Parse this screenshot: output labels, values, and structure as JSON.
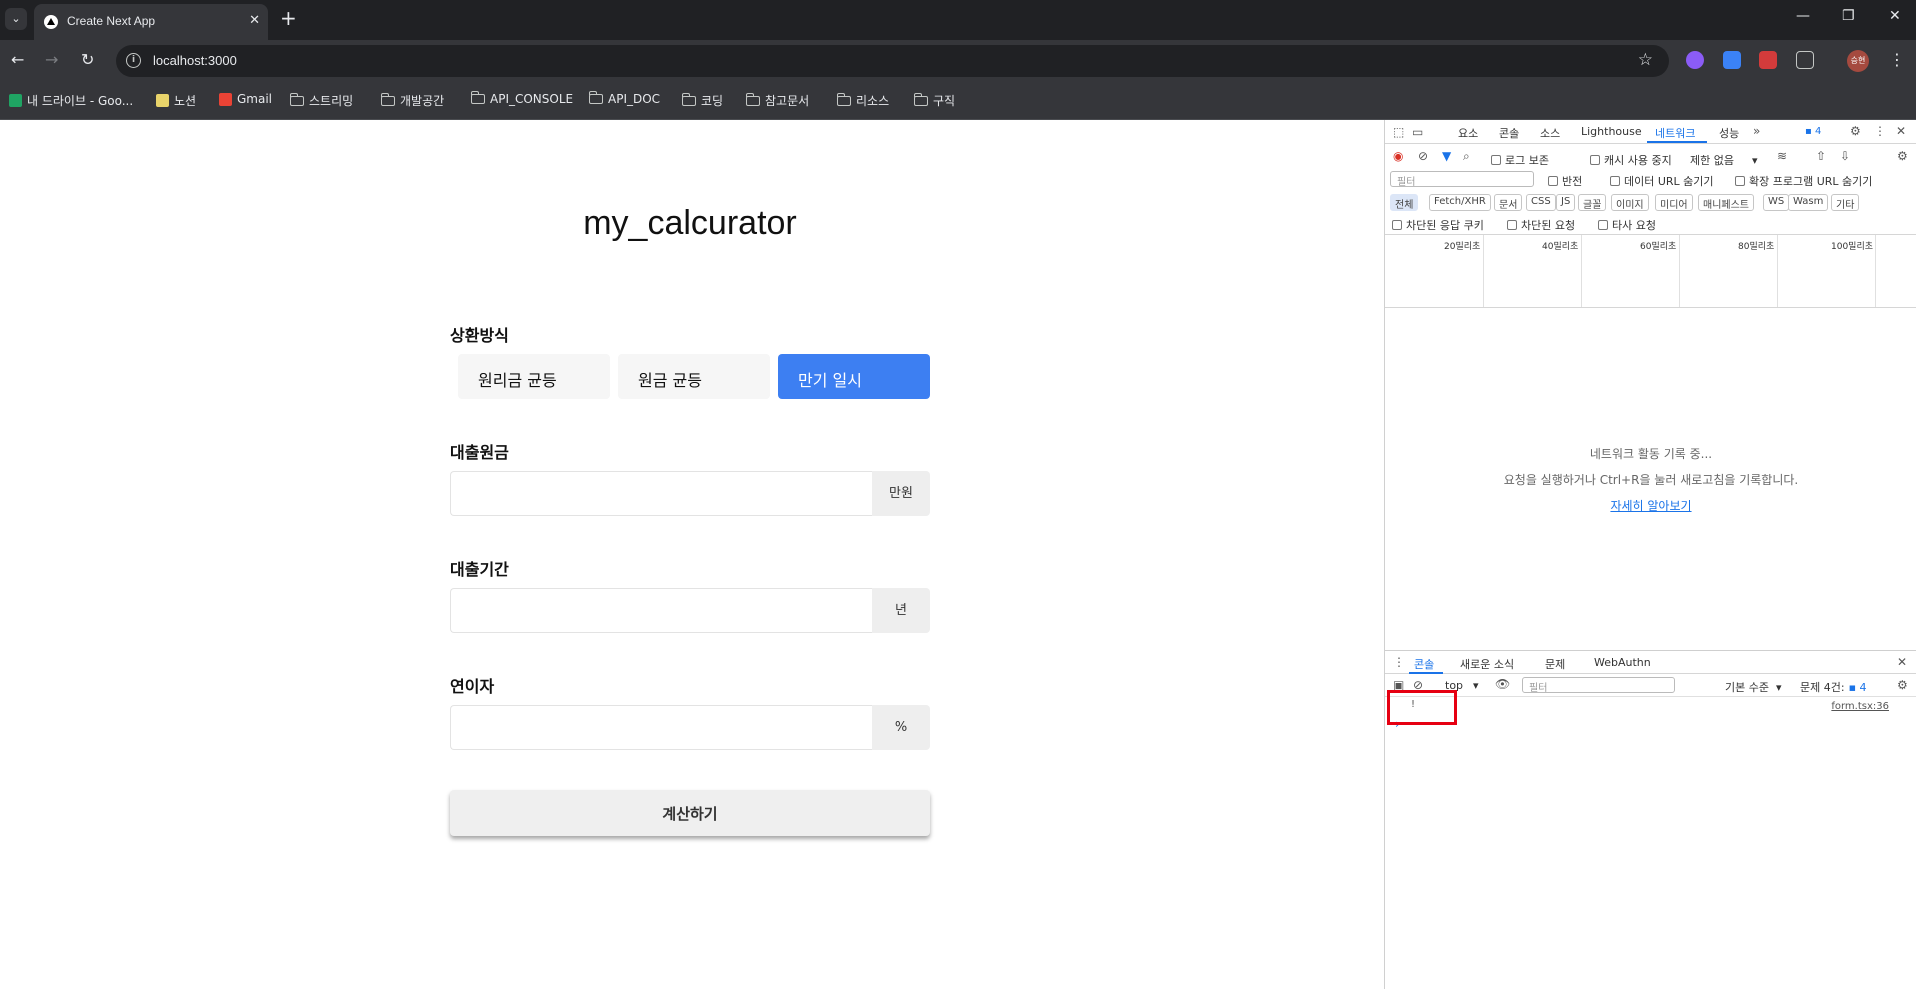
{
  "browser": {
    "tab_title": "Create Next App",
    "url": "localhost:3000",
    "profile_initials": "승현",
    "bookmarks": [
      "내 드라이브 - Goo...",
      "노션",
      "Gmail",
      "스트리밍",
      "개발공간",
      "API_CONSOLE",
      "API_DOC",
      "코딩",
      "참고문서",
      "리소스",
      "구직"
    ]
  },
  "page": {
    "title": "my_calcurator",
    "repayment_label": "상환방식",
    "repayment_options": [
      "원리금 균등",
      "원금 균등",
      "만기 일시"
    ],
    "selected_option": "만기 일시",
    "principal_label": "대출원금",
    "principal_value": "",
    "principal_unit": "만원",
    "period_label": "대출기간",
    "period_value": "",
    "period_unit": "년",
    "rate_label": "연이자",
    "rate_value": "",
    "rate_unit": "%",
    "submit_label": "계산하기",
    "accent_color": "#3d7ff2"
  },
  "devtools": {
    "main_tabs": [
      "요소",
      "콘솔",
      "소스",
      "Lighthouse",
      "네트워크",
      "성능"
    ],
    "active_tab": "네트워크",
    "issue_badge": "4",
    "network": {
      "preserve_log": "로그 보존",
      "disable_cache": "캐시 사용 중지",
      "throttling": "제한 없음",
      "filter_placeholder": "필터",
      "invert": "반전",
      "hide_data_urls": "데이터 URL 숨기기",
      "hide_ext_urls": "확장 프로그램 URL 숨기기",
      "type_filters": [
        "전체",
        "Fetch/XHR",
        "문서",
        "CSS",
        "JS",
        "글꼴",
        "이미지",
        "미디어",
        "매니페스트",
        "WS",
        "Wasm",
        "기타"
      ],
      "blocked_cookies": "차단된 응답 쿠키",
      "blocked_requests": "차단된 요청",
      "third_party": "타사 요청",
      "timeline_labels": [
        "20밀리초",
        "40밀리초",
        "60밀리초",
        "80밀리초",
        "100밀리초"
      ],
      "recording_msg": "네트워크 활동 기록 중...",
      "instruction_msg": "요청을 실행하거나 Ctrl+R을 눌러 새로고침을 기록합니다.",
      "learn_more": "자세히 알아보기"
    },
    "drawer": {
      "tabs": [
        "콘솔",
        "새로운 소식",
        "문제",
        "WebAuthn"
      ],
      "context": "top",
      "filter_placeholder": "필터",
      "levels": "기본 수준",
      "issues_label": "문제 4건:",
      "issues_count": "4",
      "log_text": "!",
      "log_source": "form.tsx:36",
      "prompt": "›"
    }
  }
}
